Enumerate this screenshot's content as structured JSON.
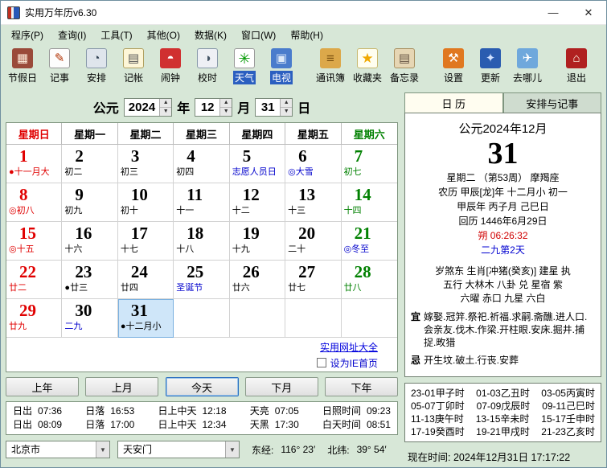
{
  "window": {
    "title": "实用万年历v6.30",
    "minimize_label": "—",
    "close_label": "✕"
  },
  "menu_items": [
    "程序(P)",
    "查询(I)",
    "工具(T)",
    "其他(O)",
    "数据(K)",
    "窗口(W)",
    "帮助(H)"
  ],
  "toolbar_groups": [
    {
      "buttons": [
        {
          "id": "holiday",
          "label": "节假日",
          "glyph": "▦",
          "active": false
        },
        {
          "id": "note",
          "label": "记事",
          "glyph": "✎",
          "active": false
        },
        {
          "id": "schedule",
          "label": "安排",
          "glyph": "◔",
          "active": false
        },
        {
          "id": "account",
          "label": "记帐",
          "glyph": "▤",
          "active": false
        },
        {
          "id": "alarm",
          "label": "闹钟",
          "glyph": "◓",
          "active": false
        },
        {
          "id": "timesync",
          "label": "校时",
          "glyph": "◑",
          "active": false
        },
        {
          "id": "weather",
          "label": "天气",
          "glyph": "✳",
          "active": true
        },
        {
          "id": "tv",
          "label": "电视",
          "glyph": "▣",
          "active": true
        }
      ]
    },
    {
      "buttons": [
        {
          "id": "contacts",
          "label": "通讯簿",
          "glyph": "≡",
          "active": false
        },
        {
          "id": "favorites",
          "label": "收藏夹",
          "glyph": "★",
          "active": false
        },
        {
          "id": "memo",
          "label": "备忘录",
          "glyph": "▤",
          "active": false
        }
      ]
    },
    {
      "buttons": [
        {
          "id": "settings",
          "label": "设置",
          "glyph": "⚒",
          "active": false
        },
        {
          "id": "update",
          "label": "更新",
          "glyph": "✦",
          "active": false
        },
        {
          "id": "travel",
          "label": "去哪儿",
          "glyph": "✈",
          "active": false
        }
      ]
    },
    {
      "buttons": [
        {
          "id": "exit",
          "label": "退出",
          "glyph": "⌂",
          "active": false
        }
      ]
    }
  ],
  "ui": {
    "spin_up": "▲",
    "spin_down": "▼",
    "dropdown_arrow": "▼"
  },
  "date_selector": {
    "era": "公元",
    "year": "2024",
    "year_unit": "年",
    "month": "12",
    "month_unit": "月",
    "day": "31",
    "day_unit": "日"
  },
  "calendar": {
    "headers": [
      {
        "label": "星期日",
        "color": "#e00000"
      },
      {
        "label": "星期一",
        "color": "#000000"
      },
      {
        "label": "星期二",
        "color": "#000000"
      },
      {
        "label": "星期三",
        "color": "#000000"
      },
      {
        "label": "星期四",
        "color": "#000000"
      },
      {
        "label": "星期五",
        "color": "#000000"
      },
      {
        "label": "星期六",
        "color": "#008000"
      }
    ],
    "weeks": [
      [
        {
          "day": "1",
          "sub": "●十一月大",
          "color": "#e00000",
          "sub_color": "#e00000"
        },
        {
          "day": "2",
          "sub": "初二",
          "color": "#000000",
          "sub_color": "#000000"
        },
        {
          "day": "3",
          "sub": "初三",
          "color": "#000000",
          "sub_color": "#000000"
        },
        {
          "day": "4",
          "sub": "初四",
          "color": "#000000",
          "sub_color": "#000000"
        },
        {
          "day": "5",
          "sub": "志愿人员日",
          "color": "#000000",
          "sub_color": "#0000cc"
        },
        {
          "day": "6",
          "sub": "◎大雪",
          "color": "#000000",
          "sub_color": "#0000cc"
        },
        {
          "day": "7",
          "sub": "初七",
          "color": "#008000",
          "sub_color": "#008000"
        }
      ],
      [
        {
          "day": "8",
          "sub": "◎初八",
          "color": "#e00000",
          "sub_color": "#e00000"
        },
        {
          "day": "9",
          "sub": "初九",
          "color": "#000000",
          "sub_color": "#000000"
        },
        {
          "day": "10",
          "sub": "初十",
          "color": "#000000",
          "sub_color": "#000000"
        },
        {
          "day": "11",
          "sub": "十一",
          "color": "#000000",
          "sub_color": "#000000"
        },
        {
          "day": "12",
          "sub": "十二",
          "color": "#000000",
          "sub_color": "#000000"
        },
        {
          "day": "13",
          "sub": "十三",
          "color": "#000000",
          "sub_color": "#000000"
        },
        {
          "day": "14",
          "sub": "十四",
          "color": "#008000",
          "sub_color": "#008000"
        }
      ],
      [
        {
          "day": "15",
          "sub": "◎十五",
          "color": "#e00000",
          "sub_color": "#e00000"
        },
        {
          "day": "16",
          "sub": "十六",
          "color": "#000000",
          "sub_color": "#000000"
        },
        {
          "day": "17",
          "sub": "十七",
          "color": "#000000",
          "sub_color": "#000000"
        },
        {
          "day": "18",
          "sub": "十八",
          "color": "#000000",
          "sub_color": "#000000"
        },
        {
          "day": "19",
          "sub": "十九",
          "color": "#000000",
          "sub_color": "#000000"
        },
        {
          "day": "20",
          "sub": "二十",
          "color": "#000000",
          "sub_color": "#000000"
        },
        {
          "day": "21",
          "sub": "◎冬至",
          "color": "#008000",
          "sub_color": "#0000cc"
        }
      ],
      [
        {
          "day": "22",
          "sub": "廿二",
          "color": "#e00000",
          "sub_color": "#e00000"
        },
        {
          "day": "23",
          "sub": "●廿三",
          "color": "#000000",
          "sub_color": "#000000"
        },
        {
          "day": "24",
          "sub": "廿四",
          "color": "#000000",
          "sub_color": "#000000"
        },
        {
          "day": "25",
          "sub": "圣诞节",
          "color": "#000000",
          "sub_color": "#0000cc"
        },
        {
          "day": "26",
          "sub": "廿六",
          "color": "#000000",
          "sub_color": "#000000"
        },
        {
          "day": "27",
          "sub": "廿七",
          "color": "#000000",
          "sub_color": "#000000"
        },
        {
          "day": "28",
          "sub": "廿八",
          "color": "#008000",
          "sub_color": "#008000"
        }
      ],
      [
        {
          "day": "29",
          "sub": "廿九",
          "color": "#e00000",
          "sub_color": "#e00000"
        },
        {
          "day": "30",
          "sub": "二九",
          "color": "#000000",
          "sub_color": "#0000cc"
        },
        {
          "day": "31",
          "sub": "●十二月小",
          "color": "#000000",
          "sub_color": "#000000",
          "selected": true
        },
        {},
        {},
        {},
        {}
      ]
    ]
  },
  "footer_links": {
    "url_link": "实用网址大全",
    "ie_checkbox_label": "设为IE首页",
    "ie_checked": false
  },
  "nav_buttons": [
    {
      "id": "prev-year",
      "label": "上年",
      "focused": false
    },
    {
      "id": "prev-month",
      "label": "上月",
      "focused": false
    },
    {
      "id": "today",
      "label": "今天",
      "focused": true
    },
    {
      "id": "next-month",
      "label": "下月",
      "focused": false
    },
    {
      "id": "next-year",
      "label": "下年",
      "focused": false
    }
  ],
  "sun_info": {
    "rows": [
      [
        {
          "label": "日出",
          "value": "07:36"
        },
        {
          "label": "日落",
          "value": "16:53"
        },
        {
          "label": "日上中天",
          "value": "12:18"
        },
        {
          "label": "天亮",
          "value": "07:05"
        },
        {
          "label": "日照时间",
          "value": "09:23"
        }
      ],
      [
        {
          "label": "日出",
          "value": "08:09"
        },
        {
          "label": "日落",
          "value": "17:00"
        },
        {
          "label": "日上中天",
          "value": "12:34"
        },
        {
          "label": "天黑",
          "value": "17:30"
        },
        {
          "label": "白天时间",
          "value": "08:51"
        }
      ]
    ]
  },
  "location": {
    "city": "北京市",
    "place": "天安门",
    "lon_label": "东经:",
    "lon": "116° 23′",
    "lat_label": "北纬:",
    "lat": "39° 54′"
  },
  "right_panel": {
    "tabs": [
      {
        "label": "日 历",
        "active": true
      },
      {
        "label": "安排与记事",
        "active": false
      }
    ],
    "detail": {
      "month_title": "公元2024年12月",
      "day_number": "31",
      "week_line": "星期二 （第53周） 摩羯座",
      "lunar_line": "农历 甲辰[龙]年 十二月小 初一",
      "ganzhi_line": "甲辰年 丙子月 己巳日",
      "hijri_line": "回历 1446年6月29日",
      "moon_phase": "朔 06:26:32",
      "nine_period": "二九第2天",
      "line_suisha": "岁煞东 生肖[冲猪(癸亥)] 建星 执",
      "line_wuxing": "五行 大林木 八卦 兑 星宿 紫",
      "line_liuyao": "六曜 赤口 九星 六白",
      "yi_label": "宜",
      "yi_text": "嫁娶.冠笄.祭祀.祈福.求嗣.斋醮.进人口.会亲友.伐木.作梁.开柱眼.安床.掘井.捕捉.畋猎",
      "ji_label": "忌",
      "ji_text": "开生坟.破土.行丧.安葬"
    },
    "hour_rows": [
      [
        "23-01甲子时",
        "01-03乙丑时",
        "03-05丙寅时"
      ],
      [
        "05-07丁卯时",
        "07-09戊辰时",
        "09-11己巳时"
      ],
      [
        "11-13庚午时",
        "13-15辛未时",
        "15-17壬申时"
      ],
      [
        "17-19癸酉时",
        "19-21甲戌时",
        "21-23乙亥时"
      ]
    ],
    "now_label": "现在时间:",
    "now_value": "2024年12月31日 17:17:22"
  }
}
